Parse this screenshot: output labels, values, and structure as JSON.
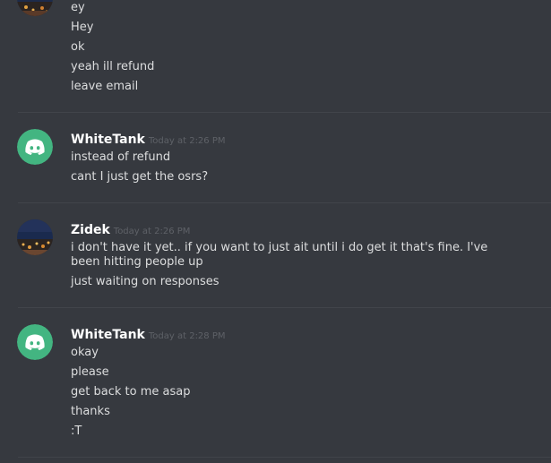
{
  "colors": {
    "background": "#36393f",
    "divider": "#41444a",
    "username": "#ffffff",
    "message_text": "#dcddde",
    "timestamp": "#5e6167",
    "discord_avatar_bg": "#43b581"
  },
  "group_top": {
    "messages": [
      "ey",
      "Hey",
      "ok",
      "yeah ill refund",
      "leave email"
    ]
  },
  "group_whitetank_1": {
    "username": "WhiteTank",
    "avatar_icon": "discord-logo-icon",
    "timestamp": "Today at 2:26 PM",
    "messages": [
      "instead of refund",
      "cant I just get the osrs?"
    ]
  },
  "group_zidek": {
    "username": "Zidek",
    "avatar_icon": "city-photo-avatar",
    "timestamp": "Today at 2:26 PM",
    "messages": [
      "i don't have it yet.. if you want to just ait until i do get it that's fine. I've been hitting people up",
      "just waiting on responses"
    ]
  },
  "group_whitetank_2": {
    "username": "WhiteTank",
    "avatar_icon": "discord-logo-icon",
    "timestamp": "Today at 2:28 PM",
    "messages": [
      "okay",
      "please",
      "get back to me asap",
      "thanks",
      ":T"
    ]
  }
}
